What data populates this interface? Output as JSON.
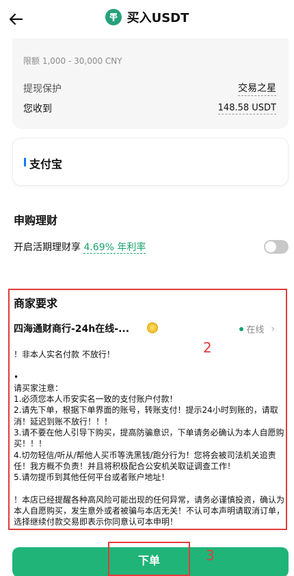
{
  "header": {
    "title": "买入USDT",
    "back_icon": "arrow-left-icon",
    "coin_icon": "usdt-icon"
  },
  "order_summary": {
    "limit": "限额 1,000 - 30,000 CNY",
    "protection_label": "提现保护",
    "protection_value": "交易之星",
    "receive_label": "您收到",
    "receive_value": "148.58 USDT"
  },
  "payment": {
    "method": "支付宝",
    "accent_color": "#1677ff"
  },
  "subscription": {
    "section_title": "申购理财",
    "toggle_label": "开启活期理财享",
    "rate": "4.69% 年利率",
    "toggle_on": false
  },
  "merchant": {
    "section_title": "商家要求",
    "name": "四海通财商行-24h在线-...",
    "status": "在线",
    "notice": "！非本人实名付款 不放行！\n\n•\n请买家注意：\n1.必须您本人币安实名一致的支付账户付款！\n2.请先下单，根据下单界面的账号，转账支付！提示24小时到账的，请取消！延迟到账不放行！！！\n3.请不要在他人引导下购买，提高防骗意识，下单请务必确认为本人自愿购买！！！\n4.切勿轻信/听从/帮他人买币等洗黑钱/跑分行为！您将会被司法机关追责任！我方概不负责！并且将积极配合公安机关取证调查工作！\n5.请勿提币到其他任何平台或者账户地址！\n\n！本店已经提醒各种高风险可能出现的任何异常，请务必谨慎投资，确认为本人自愿购买，发生意外或者被骗与本店无关！不认可本声明请取消订单，选择继续付款交易即表示你同意认可本申明！"
  },
  "annotations": {
    "label_2": "2",
    "label_3": "3",
    "color": "#e23b3b"
  },
  "actions": {
    "place_order": "下单",
    "button_color": "#20b479"
  }
}
